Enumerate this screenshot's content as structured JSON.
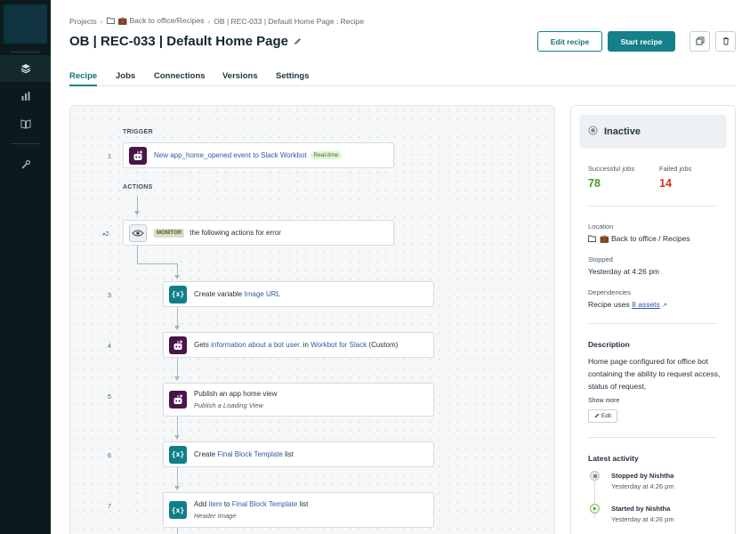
{
  "rail": {
    "items": [
      {
        "icon": "layers-icon"
      },
      {
        "icon": "bar-chart-icon"
      },
      {
        "icon": "book-icon"
      },
      {
        "icon": "wrench-icon"
      }
    ]
  },
  "breadcrumb": {
    "projects": "Projects",
    "folder": "💼 Back to office/Recipes",
    "current": "OB | REC-033 | Default Home Page : Recipe"
  },
  "header": {
    "title": "OB | REC-033 | Default Home Page",
    "edit_label": "Edit recipe",
    "start_label": "Start recipe"
  },
  "tabs": [
    "Recipe",
    "Jobs",
    "Connections",
    "Versions",
    "Settings"
  ],
  "recipe": {
    "trigger_label": "TRIGGER",
    "actions_label": "ACTIONS",
    "steps": [
      {
        "num": "1",
        "parts": [
          "New ",
          "app_home_opened",
          " event to ",
          "Slack Workbot"
        ],
        "badge": "Real-time"
      },
      {
        "num": "2",
        "tag": "MONITOR",
        "text": "the following actions for error"
      },
      {
        "num": "3",
        "prefix": "Create variable ",
        "link": "Image URL"
      },
      {
        "num": "4",
        "prefix": "Gets ",
        "link": "information about a bot user.",
        "mid": " in ",
        "link2": "Workbot for Slack",
        "suffix": " (Custom)"
      },
      {
        "num": "5",
        "text": "Publish an app home view",
        "sub": "Publish a Loading View"
      },
      {
        "num": "6",
        "prefix": "Create ",
        "link": "Final Block Template",
        "suffix": " list"
      },
      {
        "num": "7",
        "prefix": "Add ",
        "link": "item",
        "mid": " to ",
        "link2": "Final Block Template",
        "suffix": " list",
        "sub": "Header Image"
      }
    ]
  },
  "panel": {
    "status": "Inactive",
    "successful_label": "Successful jobs",
    "successful_value": "78",
    "failed_label": "Failed jobs",
    "failed_value": "14",
    "location_label": "Location",
    "location_value": "💼 Back to office / Recipes",
    "stopped_label": "Stopped",
    "stopped_value": "Yesterday at 4:26 pm",
    "dependencies_label": "Dependencies",
    "dependencies_prefix": "Recipe uses ",
    "dependencies_link": "8 assets",
    "description_label": "Description",
    "description_text": "Home page configured for office bot containing the ability to request access, status of request,",
    "show_more": "Show more",
    "edit_label": "Edit",
    "activity_label": "Latest activity",
    "activity": [
      {
        "title": "Stopped by Nishtha",
        "time": "Yesterday at 4:26 pm"
      },
      {
        "title": "Started by Nishtha",
        "time": "Yesterday at 4:26 pm"
      }
    ]
  },
  "colors": {
    "accent": "#14808a",
    "success": "#4a9a1f",
    "failed": "#d8321e",
    "slack": "#4a154b",
    "link": "#2e5aa7"
  }
}
